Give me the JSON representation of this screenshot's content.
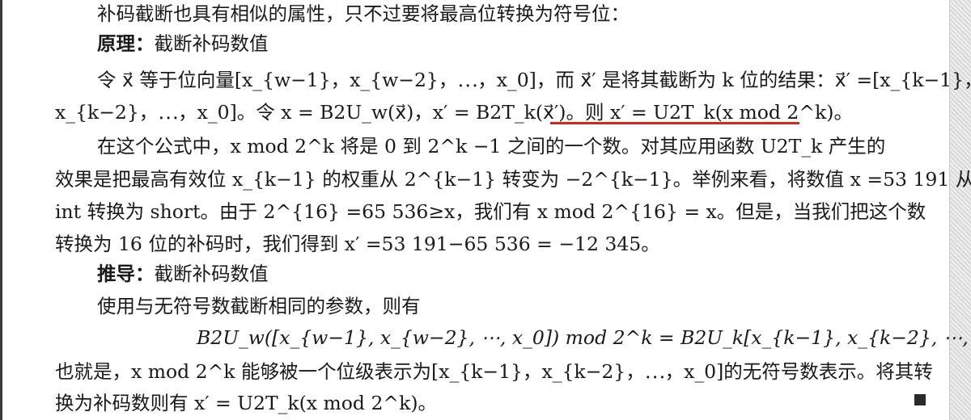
{
  "lines": [
    {
      "id": "l1",
      "text": "补码截断也具有相似的属性，只不过要将最高位转换为符号位："
    },
    {
      "id": "l2_label",
      "text": "原理："
    },
    {
      "id": "l2_rest",
      "text": "截断补码数值"
    },
    {
      "id": "l3",
      "text": "令 x⃗ 等于位向量[x_{w−1}，x_{w−2}，⋯，x_0]，而 x⃗′ 是将其截断为 k 位的结果：x⃗′ =[x_{k−1}，"
    },
    {
      "id": "l4",
      "text": "x_{k−2}，⋯，x_0]。令 x = B2U_w(x⃗)，x′ = B2T_k(x⃗′)。则 x′ = U2T_k(x mod 2^k)。"
    },
    {
      "id": "l5",
      "text": "在这个公式中，x mod 2^k 将是 0 到 2^k −1 之间的一个数。对其应用函数 U2T_k 产生的"
    },
    {
      "id": "l6",
      "text": "效果是把最高有效位 x_{k−1} 的权重从 2^{k−1} 转变为 −2^{k−1}。举例来看，将数值 x =53 191 从"
    },
    {
      "id": "l7",
      "text": "int 转换为 short。由于 2^{16} =65 536≥x，我们有 x mod 2^{16} = x。但是，当我们把这个数"
    },
    {
      "id": "l8",
      "text": "转换为 16 位的补码时，我们得到 x′ =53 191−65 536 = −12 345。"
    },
    {
      "id": "l9_label",
      "text": "推导："
    },
    {
      "id": "l9_rest",
      "text": "截断补码数值"
    },
    {
      "id": "l10",
      "text": "使用与无符号数截断相同的参数，则有"
    },
    {
      "id": "l11",
      "text": "B2U_w([x_{w−1}, x_{w−2}, ⋯, x_0]) mod 2^k = B2U_k[x_{k−1}, x_{k−2}, ⋯, x_0]"
    },
    {
      "id": "l12",
      "text": "也就是，x mod 2^k 能够被一个位级表示为[x_{k−1}，x_{k−2}，⋯，x_0]的无符号数表示。将其转"
    },
    {
      "id": "l13",
      "text": "换为补码数则有 x′ = U2T_k(x mod 2^k)。"
    }
  ],
  "highlight_color": "#d42a1e",
  "end_marker": "■"
}
